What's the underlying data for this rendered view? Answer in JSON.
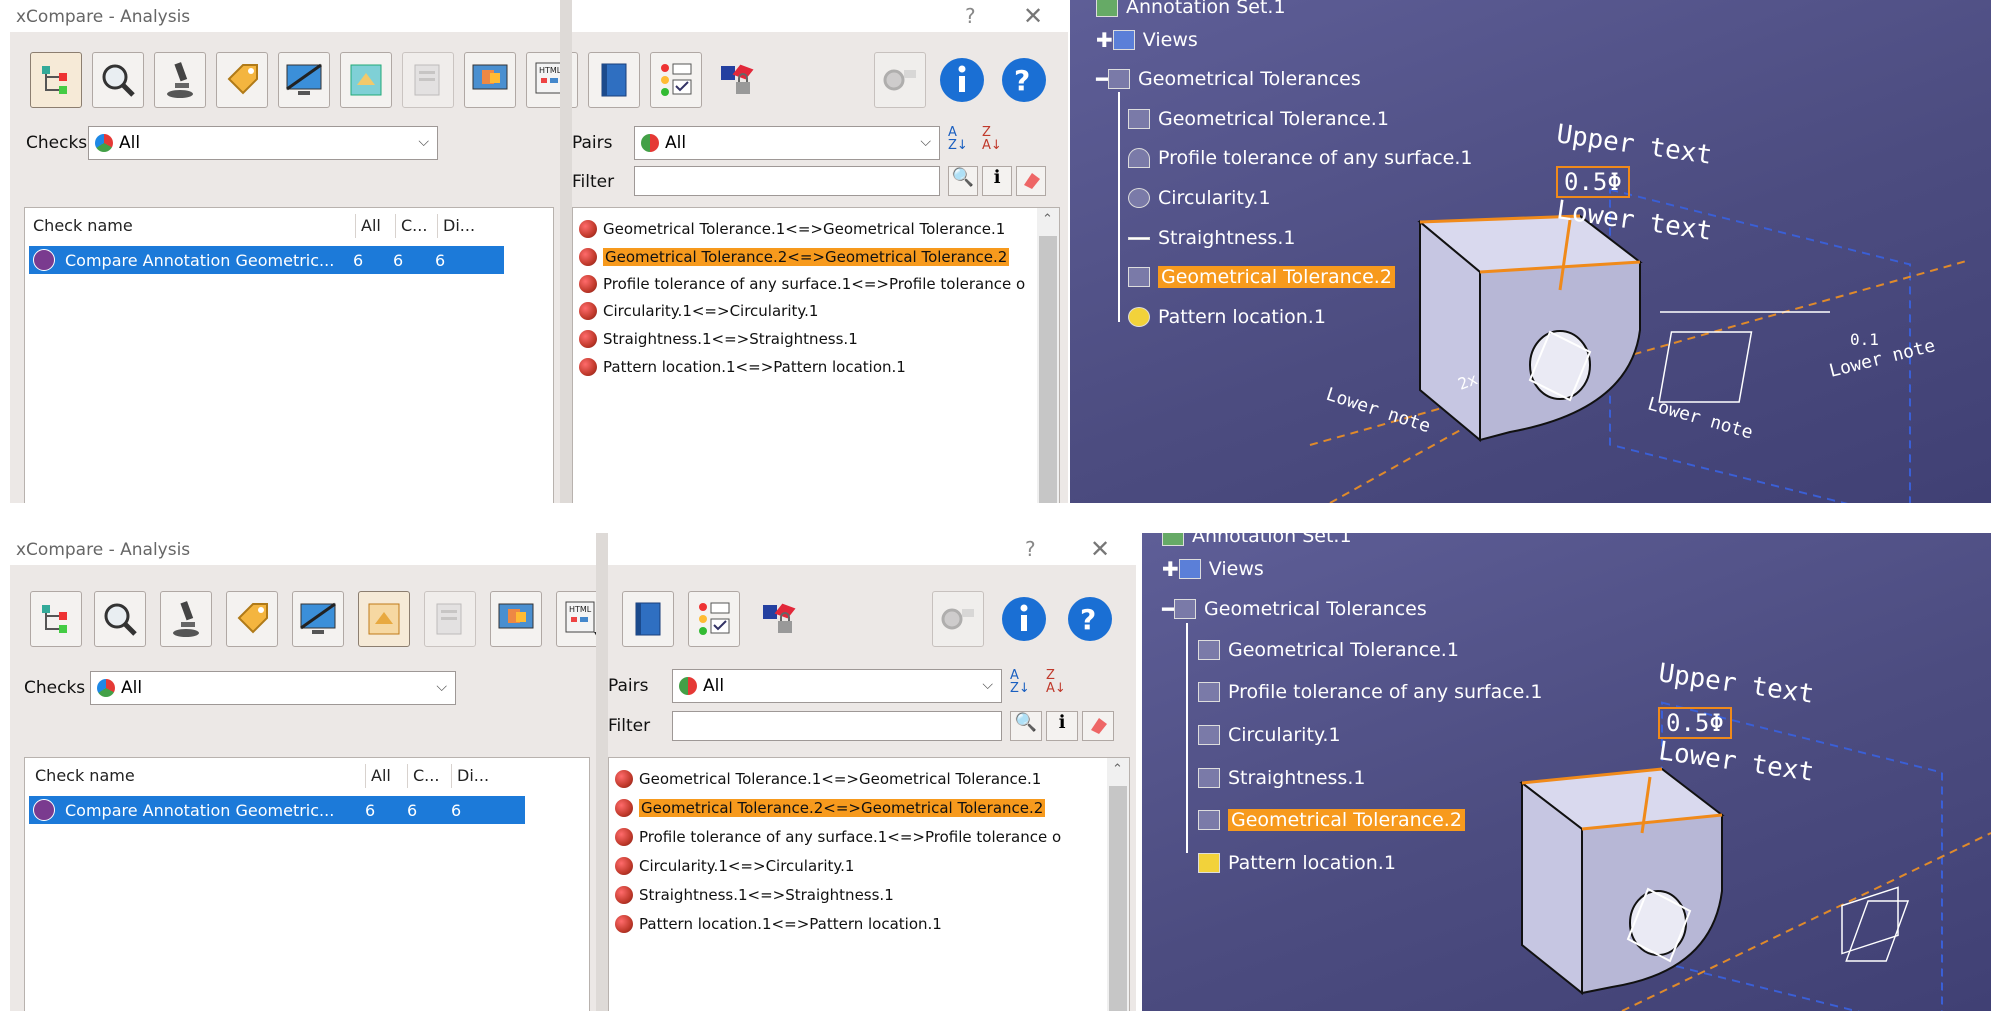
{
  "top_dialog": {
    "title": "xCompare - Analysis",
    "help": "?",
    "close": "✕",
    "checks_label": "Checks",
    "checks_value": "All",
    "pairs_label": "Pairs",
    "pairs_value": "All",
    "filter_label": "Filter",
    "filter_value": "",
    "columns": [
      "Check name",
      "All",
      "C...",
      "Di..."
    ],
    "check_row": {
      "name": "Compare Annotation Geometric...",
      "all": "6",
      "c": "6",
      "di": "6"
    },
    "pairs": [
      "Geometrical Tolerance.1<=>Geometrical Tolerance.1",
      "Geometrical Tolerance.2<=>Geometrical Tolerance.2",
      "Profile tolerance of any surface.1<=>Profile tolerance o",
      "Circularity.1<=>Circularity.1",
      "Straightness.1<=>Straightness.1",
      "Pattern location.1<=>Pattern location.1"
    ],
    "selected_pair_index": 1
  },
  "bottom_dialog": {
    "title": "xCompare - Analysis",
    "help": "?",
    "close": "✕",
    "checks_label": "Checks",
    "checks_value": "All",
    "pairs_label": "Pairs",
    "pairs_value": "All",
    "filter_label": "Filter",
    "filter_value": "",
    "columns": [
      "Check name",
      "All",
      "C...",
      "Di..."
    ],
    "check_row": {
      "name": "Compare Annotation Geometric...",
      "all": "6",
      "c": "6",
      "di": "6"
    },
    "pairs": [
      "Geometrical Tolerance.1<=>Geometrical Tolerance.1",
      "Geometrical Tolerance.2<=>Geometrical Tolerance.2",
      "Profile tolerance of any surface.1<=>Profile tolerance o",
      "Circularity.1<=>Circularity.1",
      "Straightness.1<=>Straightness.1",
      "Pattern location.1<=>Pattern location.1"
    ],
    "selected_pair_index": 1
  },
  "toolbar_icons": [
    "tree-icon",
    "magnify-icon",
    "microscope-icon",
    "tag-icon",
    "display-icon",
    "compare-icon",
    "report-icon",
    "monitor-icon",
    "html-export-icon",
    "book-icon",
    "checklist-icon",
    "lock-shapes-icon",
    "settings-icon",
    "info-icon",
    "help-icon"
  ],
  "top_view": {
    "tree_root": "Annotation Set.1",
    "tree": [
      {
        "label": "Views",
        "level": 1
      },
      {
        "label": "Geometrical Tolerances",
        "level": 1
      },
      {
        "label": "Geometrical Tolerance.1",
        "level": 2
      },
      {
        "label": "Profile tolerance of any surface.1",
        "level": 2
      },
      {
        "label": "Circularity.1",
        "level": 2
      },
      {
        "label": "Straightness.1",
        "level": 2
      },
      {
        "label": "Geometrical Tolerance.2",
        "level": 2
      },
      {
        "label": "Pattern location.1",
        "level": 2
      }
    ],
    "highlighted": "Geometrical Tolerance.2",
    "annotations": {
      "upper": "Upper text",
      "value": "0.5Φ",
      "lower": "Lower text",
      "note": "Lower note",
      "dim": "0.1",
      "count": "2x"
    }
  },
  "bottom_view": {
    "tree_root": "Annotation Set.1",
    "tree": [
      {
        "label": "Views",
        "level": 1
      },
      {
        "label": "Geometrical Tolerances",
        "level": 1
      },
      {
        "label": "Geometrical Tolerance.1",
        "level": 2
      },
      {
        "label": "Profile tolerance of any surface.1",
        "level": 2
      },
      {
        "label": "Circularity.1",
        "level": 2
      },
      {
        "label": "Straightness.1",
        "level": 2
      },
      {
        "label": "Geometrical Tolerance.2",
        "level": 2
      },
      {
        "label": "Pattern location.1",
        "level": 2
      }
    ],
    "highlighted": "Geometrical Tolerance.2",
    "annotations": {
      "upper": "Upper text",
      "value": "0.5Φ",
      "lower": "Lower text"
    }
  },
  "colors": {
    "selection_blue": "#1c7ad9",
    "highlight_orange": "#f79a1d",
    "viewport": "#4c4c80",
    "dialog_bg": "#ece8e6"
  }
}
